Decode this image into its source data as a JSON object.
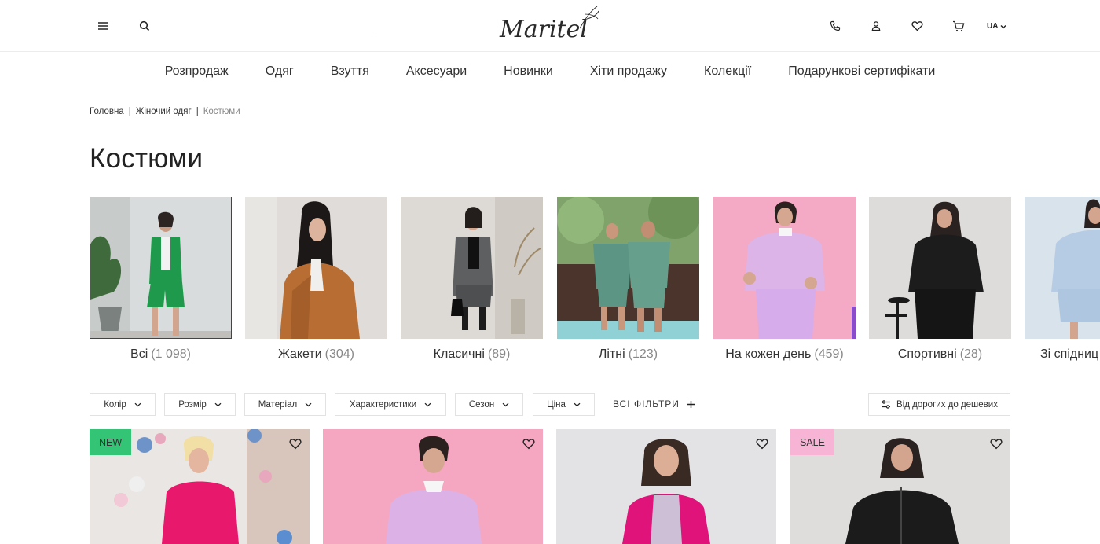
{
  "header": {
    "search_placeholder": "",
    "logo_text": "Maritel",
    "lang": "UA"
  },
  "nav": [
    "Розпродаж",
    "Одяг",
    "Взуття",
    "Аксесуари",
    "Новинки",
    "Хіти продажу",
    "Колекції",
    "Подарункові сертифікати"
  ],
  "breadcrumb": {
    "home": "Головна",
    "sep": "|",
    "parent": "Жіночий одяг",
    "current": "Костюми"
  },
  "page_title": "Костюми",
  "categories": [
    {
      "label": "Всі",
      "count": "(1 098)"
    },
    {
      "label": "Жакети",
      "count": "(304)"
    },
    {
      "label": "Класичні",
      "count": "(89)"
    },
    {
      "label": "Літні",
      "count": "(123)"
    },
    {
      "label": "На кожен день",
      "count": "(459)"
    },
    {
      "label": "Спортивні",
      "count": "(28)"
    },
    {
      "label": "Зі спідниц",
      "count": ""
    }
  ],
  "filters": {
    "color": "Колір",
    "size": "Розмір",
    "material": "Матеріал",
    "features": "Характеристики",
    "season": "Сезон",
    "price": "Ціна",
    "all": "ВСІ ФІЛЬТРИ",
    "sort": "Від дорогих до дешевих"
  },
  "products": [
    {
      "badge": "NEW"
    },
    {
      "badge": ""
    },
    {
      "badge": ""
    },
    {
      "badge": "SALE"
    }
  ]
}
